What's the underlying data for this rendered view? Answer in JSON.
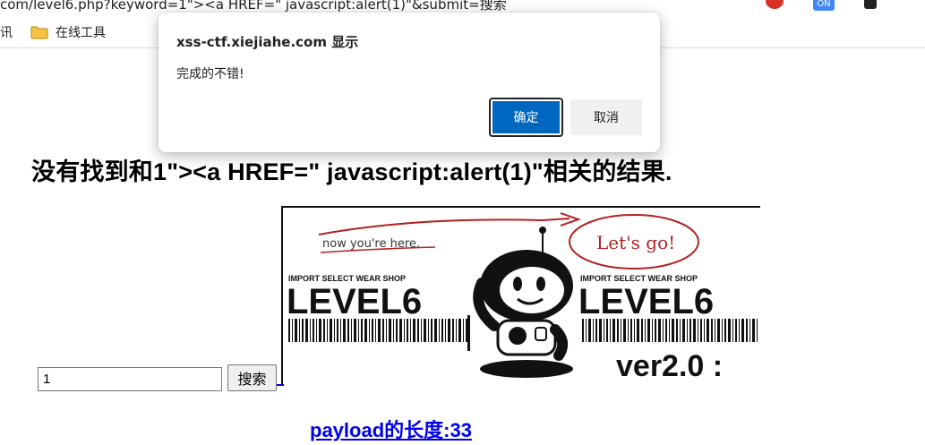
{
  "browser": {
    "address_text": "com/level6.php?keyword=1\"><a HREF=\" javascript:alert(1)\"&submit=搜索",
    "extensions": [
      {
        "name": "adblock-icon",
        "color": "#d93025"
      },
      {
        "name": "toggle-extension-icon",
        "label": "ON",
        "color": "#4285f4"
      },
      {
        "name": "puzzle-icon",
        "color": "#222222"
      }
    ],
    "bookmarks": [
      {
        "label": "讯",
        "icon": "none"
      },
      {
        "label": "在线工具",
        "icon": "folder-icon"
      }
    ]
  },
  "page": {
    "heading": "没有找到和1\"><a HREF=\" javascript:alert(1)\"相关的结果.",
    "search": {
      "value": "1",
      "button_label": "搜索"
    },
    "payload_link": "payload的长度:33",
    "banner": {
      "top_text": "now you're here.",
      "callout": "Let's go!",
      "shop_text": "IMPORT SELECT WEAR SHOP",
      "level_text": "LEVEL6",
      "version_text": "ver2.0 :"
    }
  },
  "dialog": {
    "title": "xss-ctf.xiejiahe.com 显示",
    "message": "完成的不错!",
    "ok_label": "确定",
    "cancel_label": "取消",
    "ok_color": "#0067c0"
  }
}
